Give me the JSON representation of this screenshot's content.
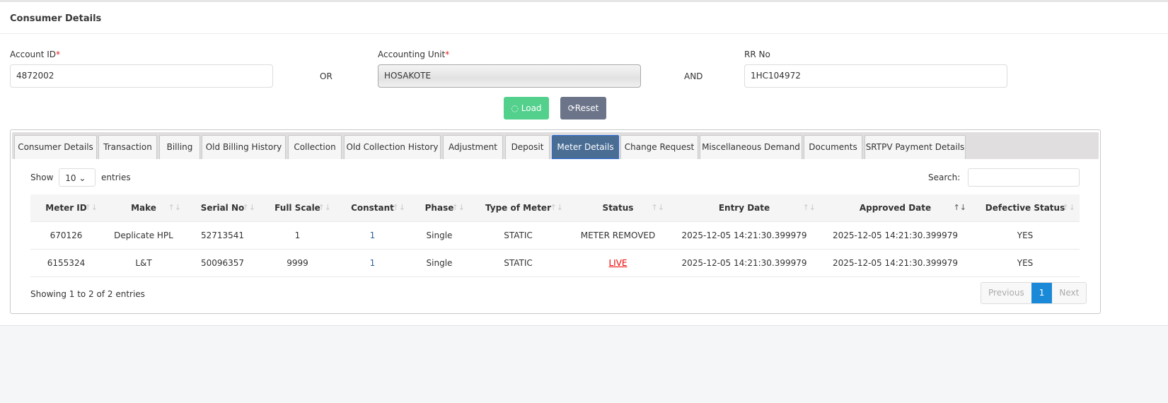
{
  "header": {
    "title": "Consumer Details"
  },
  "form": {
    "account_id": {
      "label": "Account ID",
      "required": "*",
      "value": "4872002"
    },
    "or": "OR",
    "accounting_unit": {
      "label": "Accounting Unit",
      "required": "*",
      "value": "HOSAKOTE"
    },
    "and": "AND",
    "rr_no": {
      "label": "RR No",
      "value": "1HC104972"
    },
    "load_label": "Load",
    "reset_label": "Reset"
  },
  "tabs": [
    "Consumer Details",
    "Transaction",
    "Billing",
    "Old Billing History",
    "Collection",
    "Old Collection History",
    "Adjustment",
    "Deposit",
    "Meter Details",
    "Change Request",
    "Miscellaneous Demand",
    "Documents",
    "SRTPV Payment Details"
  ],
  "active_tab": "Meter Details",
  "table": {
    "show": "Show",
    "entries_value": "10",
    "entries": "entries",
    "search_label": "Search:",
    "columns": [
      "Meter ID",
      "Make",
      "Serial No",
      "Full Scale",
      "Constant",
      "Phase",
      "Type of Meter",
      "Status",
      "Entry Date",
      "Approved Date",
      "Defective Status"
    ],
    "rows": [
      [
        "670126",
        "Deplicate HPL",
        "52713541",
        "1",
        "1",
        "Single",
        "STATIC",
        "METER REMOVED",
        "2025-12-05 14:21:30.399979",
        "2025-12-05 14:21:30.399979",
        "YES"
      ],
      [
        "6155324",
        "L&T",
        "50096357",
        "9999",
        "1",
        "Single",
        "STATIC",
        "LIVE",
        "2025-12-05 14:21:30.399979",
        "2025-12-05 14:21:30.399979",
        "YES"
      ]
    ],
    "info": "Showing 1 to 2 of 2 entries",
    "pagination": {
      "previous": "Previous",
      "current": "1",
      "next": "Next"
    }
  },
  "colors": {
    "load": "#52d08c",
    "reset": "#6c7489",
    "active_tab": "#4a6d94",
    "live": "#ee0000",
    "page_current": "#1a8ad8"
  }
}
